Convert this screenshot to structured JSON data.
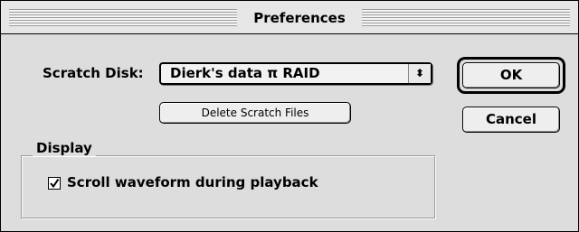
{
  "window": {
    "title": "Preferences"
  },
  "scratch_disk": {
    "label": "Scratch Disk:",
    "selected": "Dierk's data π RAID",
    "arrows_icon": "⬍",
    "delete_label": "Delete Scratch Files"
  },
  "buttons": {
    "ok": "OK",
    "cancel": "Cancel"
  },
  "display": {
    "group_label": "Display",
    "scroll_waveform": {
      "label": "Scroll waveform during playback",
      "checked": true
    }
  }
}
